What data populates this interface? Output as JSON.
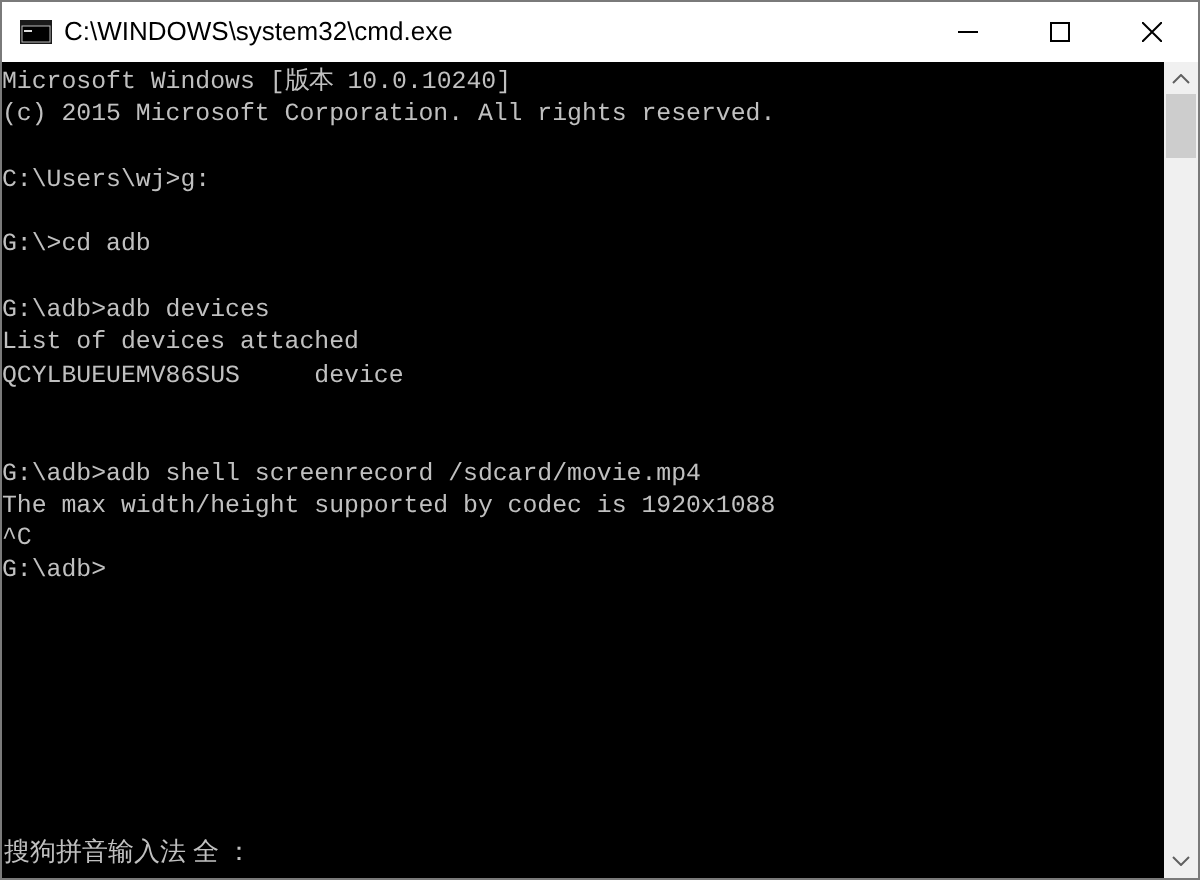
{
  "window": {
    "title": "C:\\WINDOWS\\system32\\cmd.exe"
  },
  "console": {
    "lines": [
      {
        "kind": "text",
        "text": "Microsoft Windows [版本 10.0.10240]"
      },
      {
        "kind": "text",
        "text": "(c) 2015 Microsoft Corporation. All rights reserved."
      },
      {
        "kind": "blank"
      },
      {
        "kind": "text",
        "text": "C:\\Users\\wj>g:"
      },
      {
        "kind": "blank"
      },
      {
        "kind": "text",
        "text": "G:\\>cd adb"
      },
      {
        "kind": "blank"
      },
      {
        "kind": "text",
        "text": "G:\\adb>adb devices"
      },
      {
        "kind": "text",
        "text": "List of devices attached"
      },
      {
        "kind": "text",
        "text": "QCYLBUEUEMV86SUS\tdevice"
      },
      {
        "kind": "blank"
      },
      {
        "kind": "blank"
      },
      {
        "kind": "text",
        "text": "G:\\adb>adb shell screenrecord /sdcard/movie.mp4"
      },
      {
        "kind": "text",
        "text": "The max width/height supported by codec is 1920x1088"
      },
      {
        "kind": "text",
        "text": "^C"
      },
      {
        "kind": "text",
        "text": "G:\\adb>"
      }
    ]
  },
  "ime_bar": {
    "text": "搜狗拼音输入法 全 ："
  }
}
